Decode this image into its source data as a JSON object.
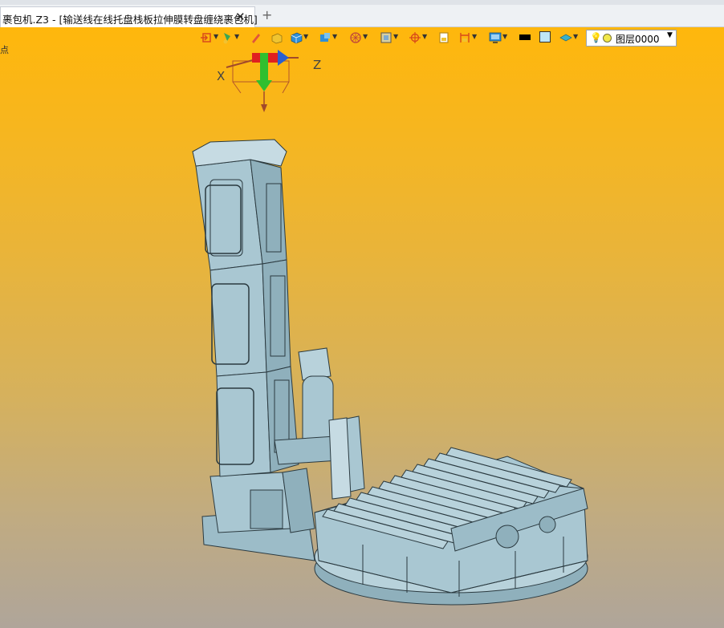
{
  "tabs": [
    {
      "label": "裹包机.Z3 - [输送线在线托盘栈板拉伸膜转盘缠绕裹包机]",
      "active": true
    }
  ],
  "tab_close_icon": "✕",
  "tab_add_icon": "+",
  "viewport": {
    "edge_text": "点",
    "axes": {
      "x": "X",
      "z": "Z"
    }
  },
  "toolbar": {
    "icons": [
      "exit-icon",
      "paint-icon",
      "pencil-icon",
      "solid-box-icon",
      "cube-icon",
      "view-cube-icon",
      "wheel-icon",
      "frame-icon",
      "target-icon",
      "page-icon",
      "dimension-icon",
      "display-icon",
      "line-color-icon",
      "fill-color-icon",
      "layer-stack-icon"
    ],
    "colors": {
      "line": "#000000",
      "fill": "#bfe6f5"
    },
    "layer_select": {
      "value": "图层0000"
    }
  },
  "colors": {
    "background_top": "#ffb70c",
    "background_bottom": "#afa59a",
    "model": "#a9c7d2",
    "model_shadow": "#7fa4b0",
    "outline": "#2b3a40"
  }
}
